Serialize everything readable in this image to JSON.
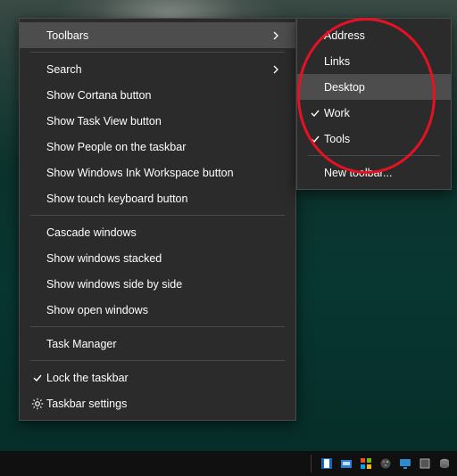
{
  "main_menu": {
    "toolbars": "Toolbars",
    "search": "Search",
    "show_cortana": "Show Cortana button",
    "show_taskview": "Show Task View button",
    "show_people": "Show People on the taskbar",
    "show_ink": "Show Windows Ink Workspace button",
    "show_touch_kb": "Show touch keyboard button",
    "cascade": "Cascade windows",
    "stacked": "Show windows stacked",
    "side_by_side": "Show windows side by side",
    "show_open": "Show open windows",
    "task_manager": "Task Manager",
    "lock_taskbar": "Lock the taskbar",
    "taskbar_settings": "Taskbar settings"
  },
  "sub_menu": {
    "address": "Address",
    "links": "Links",
    "desktop": "Desktop",
    "work": "Work",
    "tools": "Tools",
    "new_toolbar": "New toolbar..."
  },
  "checks": {
    "lock_taskbar": true,
    "work": true,
    "tools": true
  },
  "annotation": {
    "shape": "ellipse",
    "color": "#e81123"
  }
}
